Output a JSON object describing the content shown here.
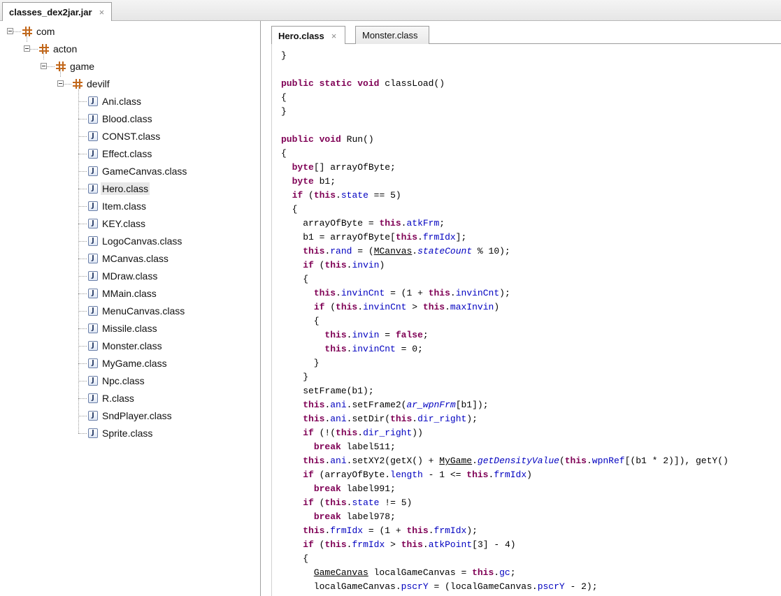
{
  "file_tab": {
    "label": "classes_dex2jar.jar",
    "close_glyph": "×"
  },
  "tree": {
    "packages": [
      "com",
      "acton",
      "game",
      "devilf"
    ],
    "classes": [
      "Ani.class",
      "Blood.class",
      "CONST.class",
      "Effect.class",
      "GameCanvas.class",
      "Hero.class",
      "Item.class",
      "KEY.class",
      "LogoCanvas.class",
      "MCanvas.class",
      "MDraw.class",
      "MMain.class",
      "MenuCanvas.class",
      "Missile.class",
      "Monster.class",
      "MyGame.class",
      "Npc.class",
      "R.class",
      "SndPlayer.class",
      "Sprite.class"
    ],
    "selected": "Hero.class",
    "class_icon_glyph": "J"
  },
  "editor_tabs": [
    {
      "label": "Hero.class",
      "active": true,
      "close_glyph": "×"
    },
    {
      "label": "Monster.class",
      "active": false
    }
  ],
  "code_lines": [
    "}",
    "",
    "public static void classLoad()",
    "{",
    "}",
    "",
    "public void Run()",
    "{",
    "  byte[] arrayOfByte;",
    "  byte b1;",
    "  if (this.state == 5)",
    "  {",
    "    arrayOfByte = this.atkFrm;",
    "    b1 = arrayOfByte[this.frmIdx];",
    "    this.rand = (MCanvas.stateCount % 10);",
    "    if (this.invin)",
    "    {",
    "      this.invinCnt = (1 + this.invinCnt);",
    "      if (this.invinCnt > this.maxInvin)",
    "      {",
    "        this.invin = false;",
    "        this.invinCnt = 0;",
    "      }",
    "    }",
    "    setFrame(b1);",
    "    this.ani.setFrame2(ar_wpnFrm[b1]);",
    "    this.ani.setDir(this.dir_right);",
    "    if (!(this.dir_right))",
    "      break label511;",
    "    this.ani.setXY2(getX() + MyGame.getDensityValue(this.wpnRef[(b1 * 2)]), getY()",
    "    if (arrayOfByte.length - 1 <= this.frmIdx)",
    "      break label991;",
    "    if (this.state != 5)",
    "      break label978;",
    "    this.frmIdx = (1 + this.frmIdx);",
    "    if (this.frmIdx > this.atkPoint[3] - 4)",
    "    {",
    "      GameCanvas localGameCanvas = this.gc;",
    "      localGameCanvas.pscrY = (localGameCanvas.pscrY - 2);"
  ]
}
